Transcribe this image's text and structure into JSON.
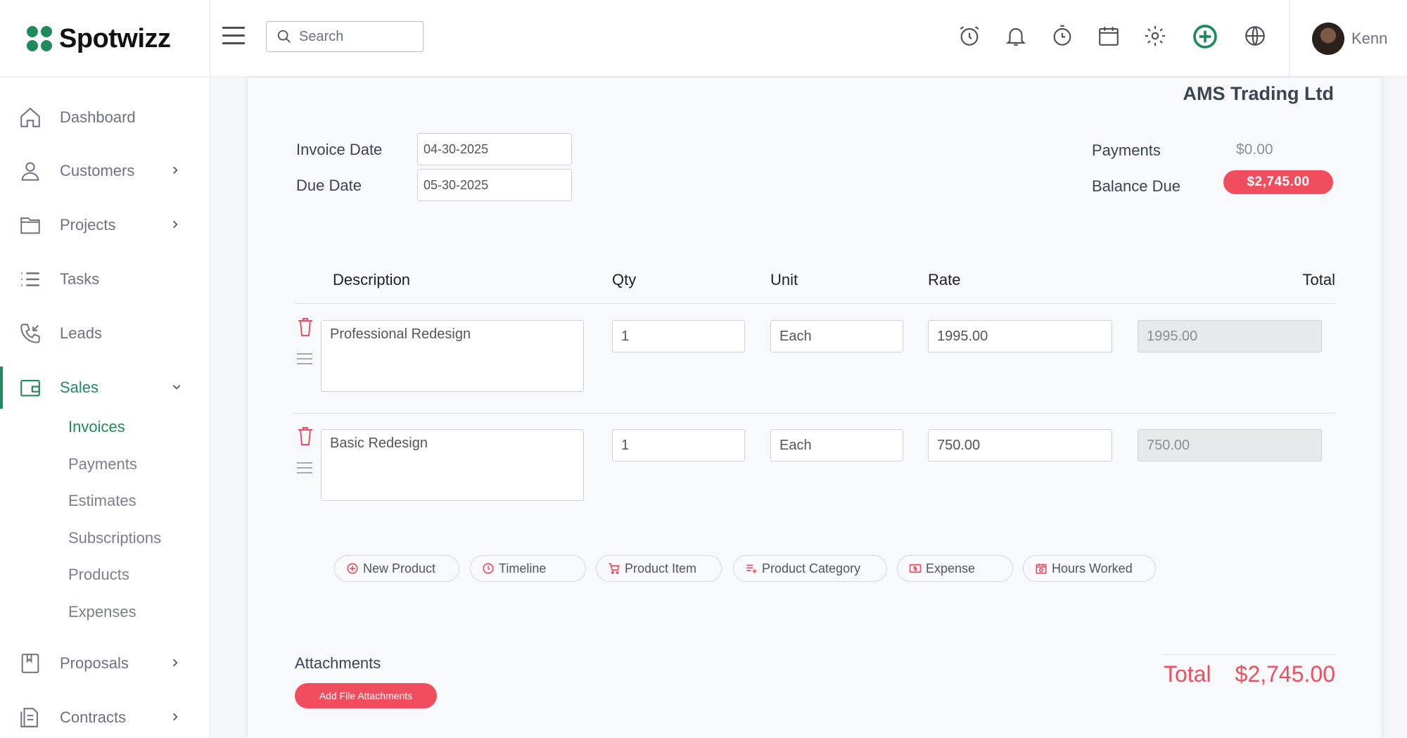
{
  "brand": {
    "name": "Spotwizz"
  },
  "search": {
    "placeholder": "Search"
  },
  "user": {
    "name": "Kenn"
  },
  "colors": {
    "brand": "#1f8a5b",
    "accent_red": "#f04e5e"
  },
  "top_icons": [
    "alarm-clock-icon",
    "bell-icon",
    "timer-icon",
    "calendar-icon",
    "gear-icon",
    "add-circle-icon",
    "globe-icon"
  ],
  "sidebar": {
    "items": [
      {
        "label": "Dashboard",
        "icon": "home-icon"
      },
      {
        "label": "Customers",
        "icon": "users-icon"
      },
      {
        "label": "Projects",
        "icon": "folder-icon"
      },
      {
        "label": "Tasks",
        "icon": "list-icon"
      },
      {
        "label": "Leads",
        "icon": "phone-incoming-icon"
      },
      {
        "label": "Sales",
        "icon": "wallet-icon"
      },
      {
        "label": "Proposals",
        "icon": "bookmark-book-icon"
      },
      {
        "label": "Contracts",
        "icon": "document-icon"
      }
    ],
    "sales_sub": [
      "Invoices",
      "Payments",
      "Estimates",
      "Subscriptions",
      "Products",
      "Expenses"
    ]
  },
  "invoice": {
    "company": "AMS Trading Ltd",
    "invoice_date_label": "Invoice Date",
    "invoice_date": "04-30-2025",
    "due_date_label": "Due Date",
    "due_date": "05-30-2025",
    "payments_label": "Payments",
    "payments_value": "$0.00",
    "balance_label": "Balance Due",
    "balance_value": "$2,745.00"
  },
  "table": {
    "headers": {
      "description": "Description",
      "qty": "Qty",
      "unit": "Unit",
      "rate": "Rate",
      "total": "Total"
    },
    "rows": [
      {
        "description": "Professional Redesign",
        "qty": "1",
        "unit": "Each",
        "rate": "1995.00",
        "total": "1995.00"
      },
      {
        "description": "Basic Redesign",
        "qty": "1",
        "unit": "Each",
        "rate": "750.00",
        "total": "750.00"
      }
    ]
  },
  "chips": [
    "New Product",
    "Timeline",
    "Product Item",
    "Product Category",
    "Expense",
    "Hours Worked"
  ],
  "attachments": {
    "title": "Attachments",
    "button": "Add File Attachments"
  },
  "totals": {
    "label": "Total",
    "value": "$2,745.00"
  }
}
